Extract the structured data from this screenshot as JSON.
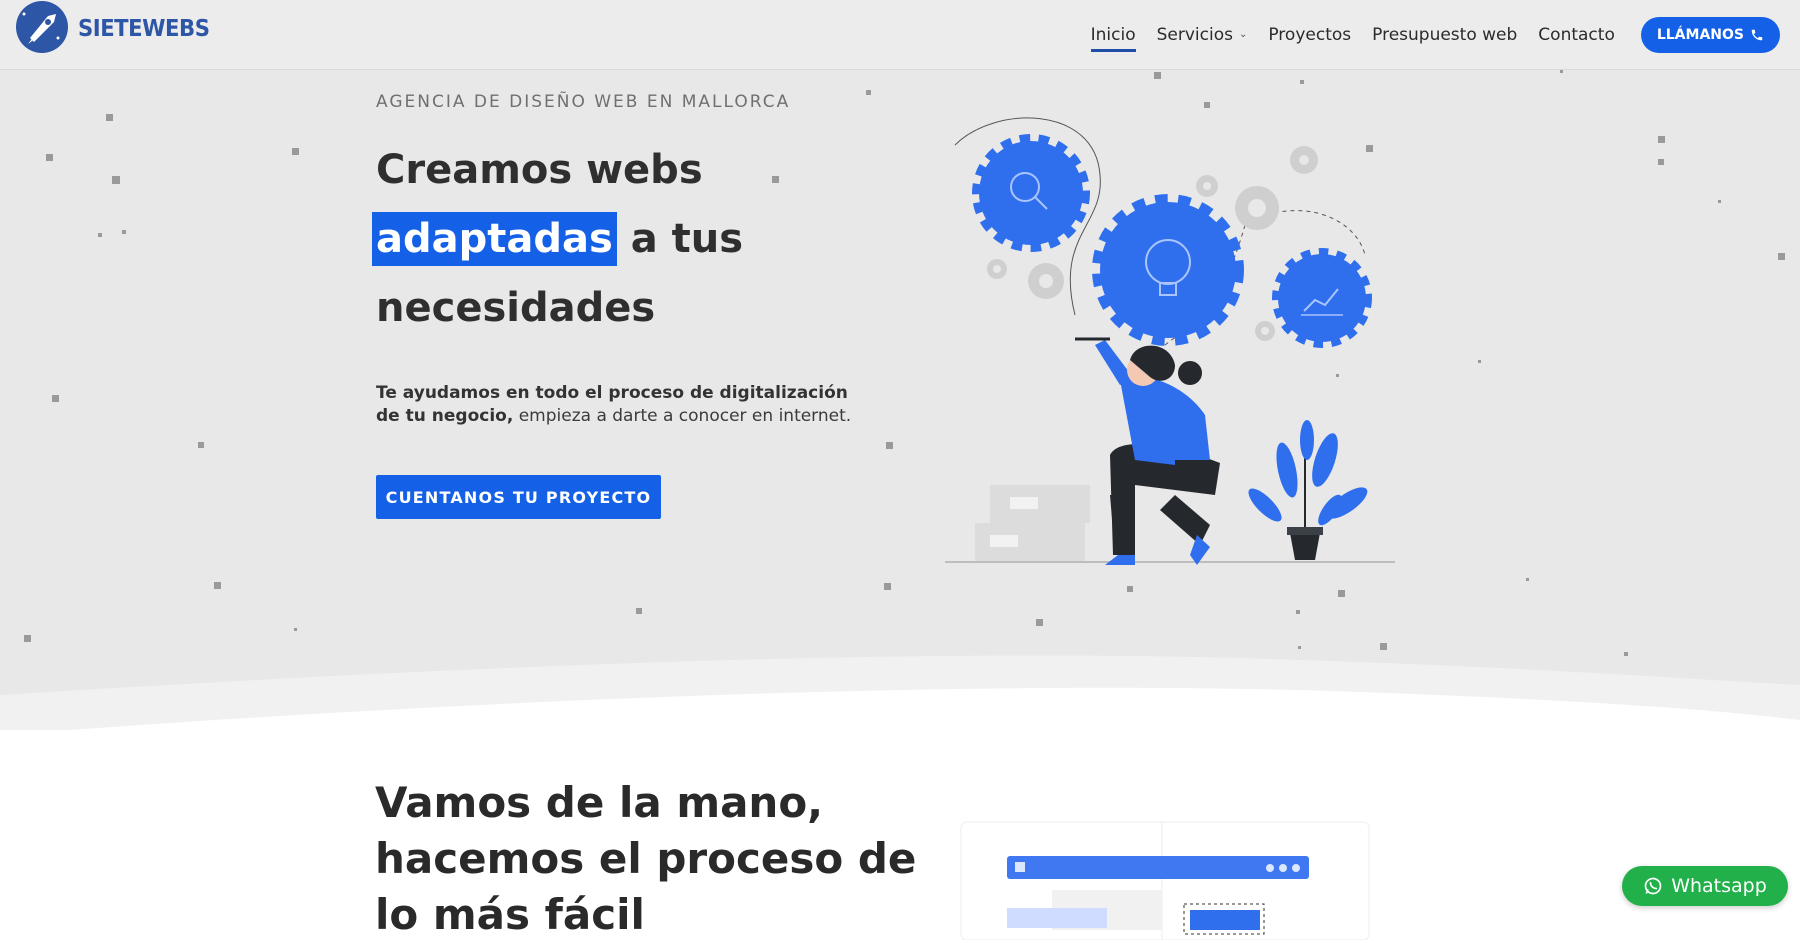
{
  "brand": {
    "name": "SIETEWEBS"
  },
  "nav": {
    "items": [
      {
        "label": "Inicio",
        "active": true
      },
      {
        "label": "Servicios",
        "has_dropdown": true
      },
      {
        "label": "Proyectos"
      },
      {
        "label": "Presupuesto web"
      },
      {
        "label": "Contacto"
      }
    ],
    "call_button": "LLÁMANOS"
  },
  "hero": {
    "eyebrow": "AGENCIA DE DISEÑO WEB EN MALLORCA",
    "headline_line1": "Creamos webs",
    "headline_highlight": "adaptadas",
    "headline_line2_rest": " a tus",
    "headline_line3": "necesidades",
    "sub_bold": "Te ayudamos en todo el proceso de digitalización de tu negocio,",
    "sub_rest": " empieza a darte a conocer en internet.",
    "cta": "CUENTANOS TU PROYECTO"
  },
  "section2": {
    "title": "Vamos de la mano, hacemos el proceso de lo más fácil"
  },
  "floating": {
    "whatsapp": "Whatsapp"
  },
  "colors": {
    "accent": "#1460e6",
    "logo": "#2e56a6",
    "whatsapp": "#22b04a",
    "hero_bg": "#e8e8e8"
  },
  "icons": [
    "rocket-logo-icon",
    "chevron-down-icon",
    "phone-icon",
    "whatsapp-icon",
    "gear-icon",
    "lightbulb-icon",
    "magnifier-icon",
    "chart-icon",
    "plant-icon"
  ]
}
